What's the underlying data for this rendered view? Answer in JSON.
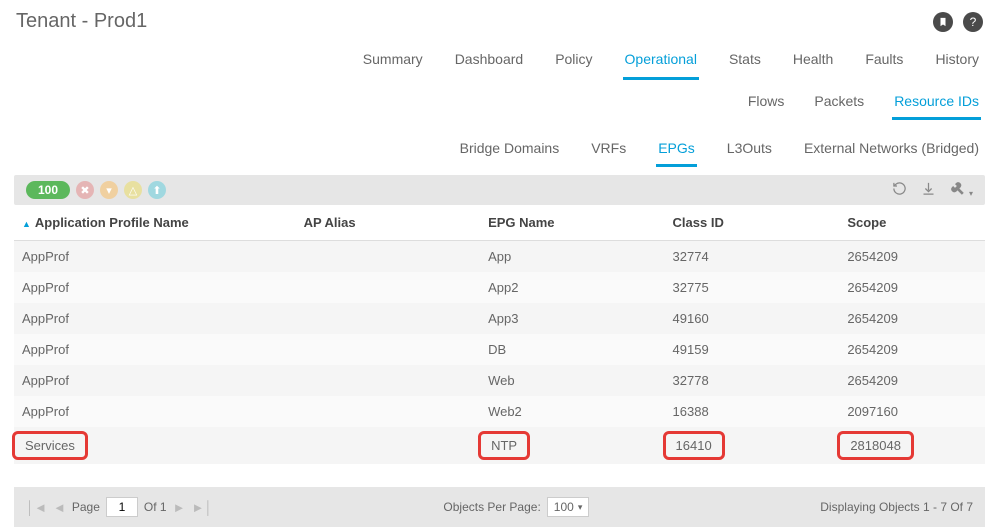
{
  "title": "Tenant - Prod1",
  "tabs": {
    "row1": [
      "Summary",
      "Dashboard",
      "Policy",
      "Operational",
      "Stats",
      "Health",
      "Faults",
      "History"
    ],
    "row1_active": 3,
    "row2": [
      "Flows",
      "Packets",
      "Resource IDs"
    ],
    "row2_active": 2,
    "row3": [
      "Bridge Domains",
      "VRFs",
      "EPGs",
      "L3Outs",
      "External Networks (Bridged)"
    ],
    "row3_active": 2
  },
  "actionbar": {
    "badge": "100"
  },
  "columns": [
    "Application Profile Name",
    "AP Alias",
    "EPG Name",
    "Class ID",
    "Scope"
  ],
  "rows": [
    {
      "ap": "AppProf",
      "alias": "",
      "epg": "App",
      "classid": "32774",
      "scope": "2654209",
      "hl": false
    },
    {
      "ap": "AppProf",
      "alias": "",
      "epg": "App2",
      "classid": "32775",
      "scope": "2654209",
      "hl": false
    },
    {
      "ap": "AppProf",
      "alias": "",
      "epg": "App3",
      "classid": "49160",
      "scope": "2654209",
      "hl": false
    },
    {
      "ap": "AppProf",
      "alias": "",
      "epg": "DB",
      "classid": "49159",
      "scope": "2654209",
      "hl": false
    },
    {
      "ap": "AppProf",
      "alias": "",
      "epg": "Web",
      "classid": "32778",
      "scope": "2654209",
      "hl": false
    },
    {
      "ap": "AppProf",
      "alias": "",
      "epg": "Web2",
      "classid": "16388",
      "scope": "2097160",
      "hl": false
    },
    {
      "ap": "Services",
      "alias": "",
      "epg": "NTP",
      "classid": "16410",
      "scope": "2818048",
      "hl": true
    }
  ],
  "footer": {
    "page_label": "Page",
    "page_current": "1",
    "page_of": "Of 1",
    "objects_per_page_label": "Objects Per Page:",
    "objects_per_page_value": "100",
    "summary": "Displaying Objects 1 - 7 Of 7"
  }
}
